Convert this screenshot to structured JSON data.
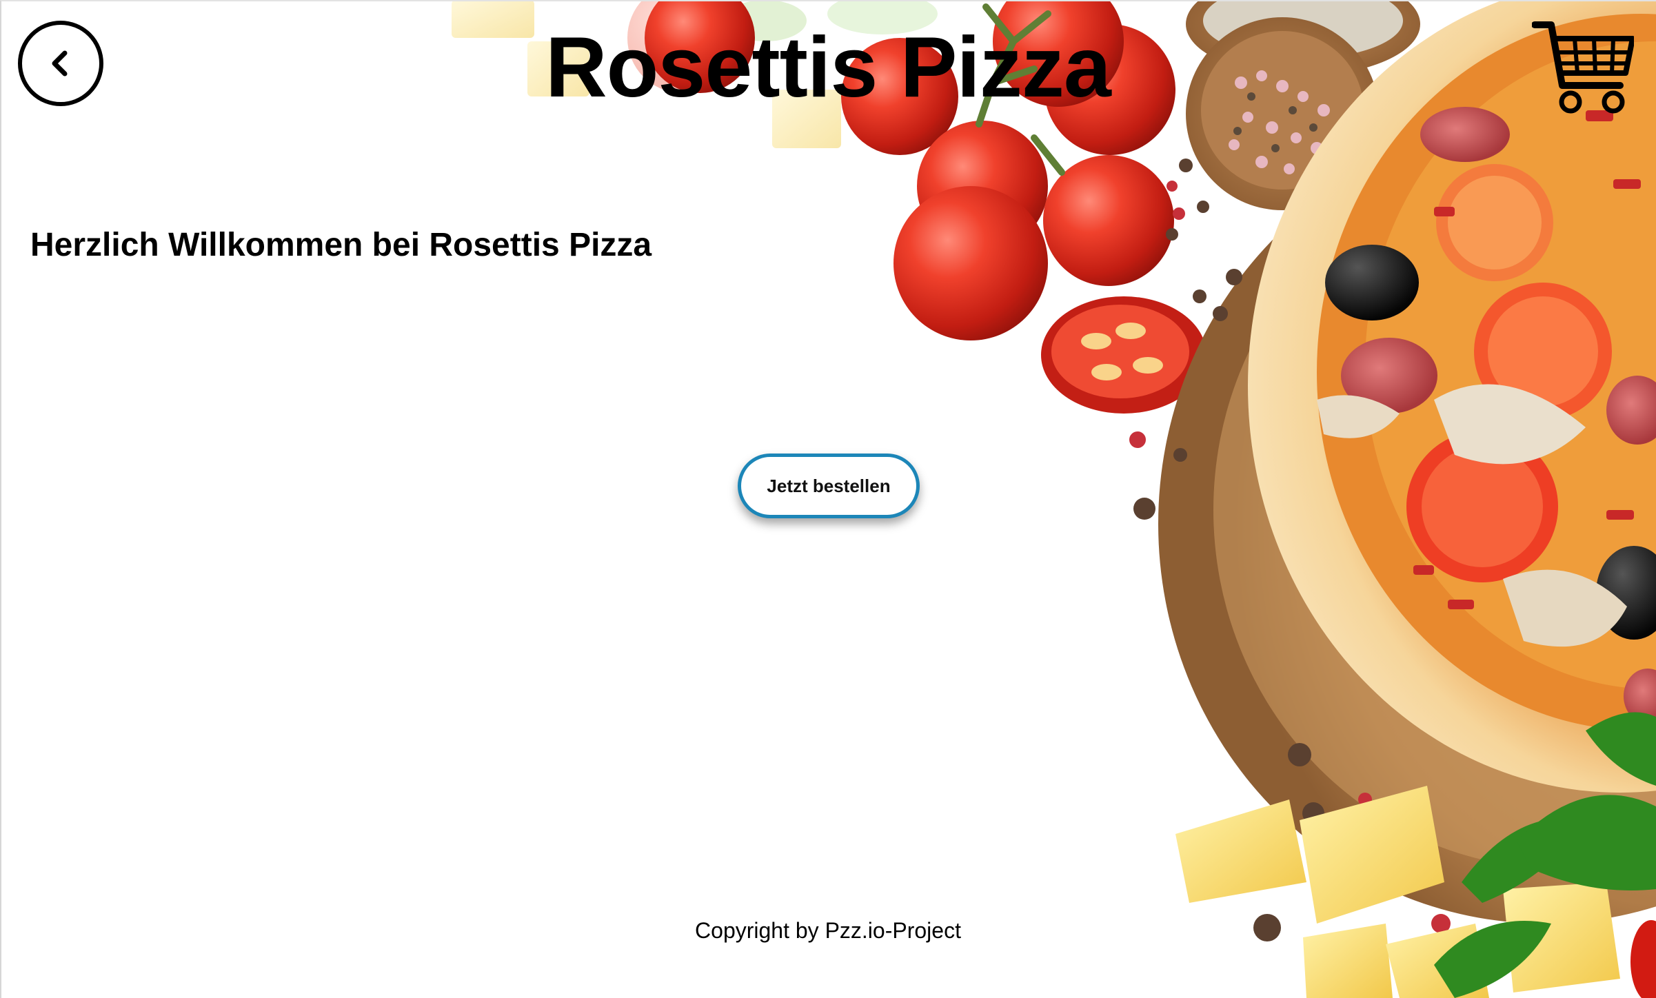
{
  "header": {
    "title": "Rosettis Pizza",
    "back_icon": "chevron-left-icon",
    "cart_icon": "shopping-cart-icon"
  },
  "main": {
    "welcome_text": "Herzlich Willkommen bei Rosettis Pizza",
    "order_button_label": "Jetzt bestellen"
  },
  "footer": {
    "copyright": "Copyright by Pzz.io-Project"
  },
  "colors": {
    "order_button_border": "#1c86b8",
    "text": "#000000",
    "background": "#ffffff"
  }
}
